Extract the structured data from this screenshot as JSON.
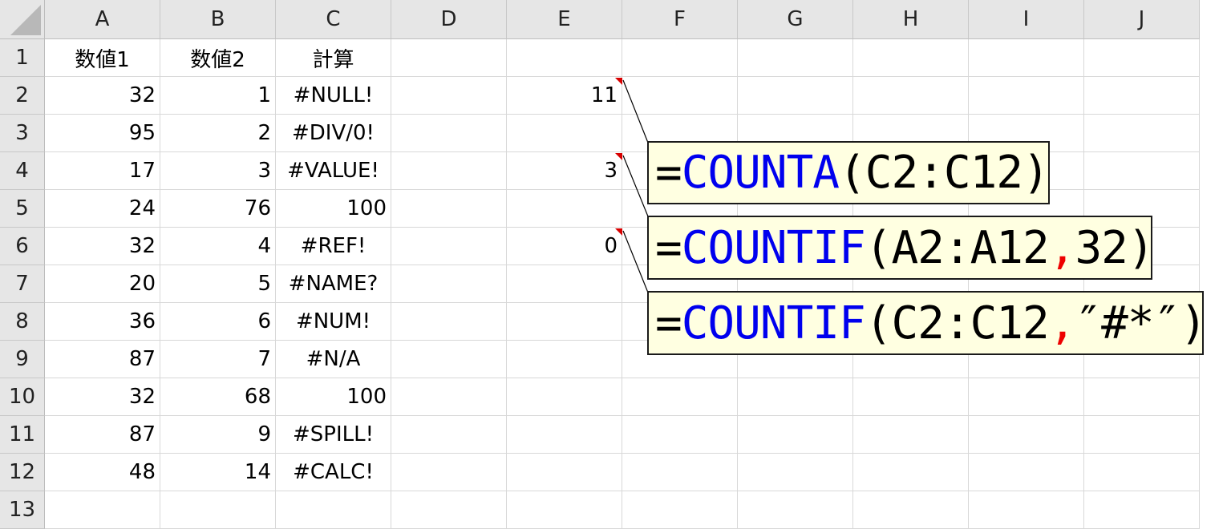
{
  "spreadsheet": {
    "columns": [
      "A",
      "B",
      "C",
      "D",
      "E",
      "F",
      "G",
      "H",
      "I",
      "J"
    ],
    "rows": [
      "1",
      "2",
      "3",
      "4",
      "5",
      "6",
      "7",
      "8",
      "9",
      "10",
      "11",
      "12",
      "13"
    ],
    "headers": {
      "a1": "数値1",
      "b1": "数値2",
      "c1": "計算"
    },
    "data": [
      {
        "a": "32",
        "b": "1",
        "c": "#NULL!"
      },
      {
        "a": "95",
        "b": "2",
        "c": "#DIV/0!"
      },
      {
        "a": "17",
        "b": "3",
        "c": "#VALUE!"
      },
      {
        "a": "24",
        "b": "76",
        "c": "100"
      },
      {
        "a": "32",
        "b": "4",
        "c": "#REF!"
      },
      {
        "a": "20",
        "b": "5",
        "c": "#NAME?"
      },
      {
        "a": "36",
        "b": "6",
        "c": "#NUM!"
      },
      {
        "a": "87",
        "b": "7",
        "c": "#N/A"
      },
      {
        "a": "32",
        "b": "68",
        "c": "100"
      },
      {
        "a": "87",
        "b": "9",
        "c": "#SPILL!"
      },
      {
        "a": "48",
        "b": "14",
        "c": "#CALC!"
      }
    ],
    "results": {
      "e2": "11",
      "e4": "3",
      "e6": "0"
    }
  },
  "comments": [
    {
      "eq": "=",
      "fn": "COUNTA",
      "args": "(C2:C12)",
      "crit": "",
      "sep": "",
      "close": ""
    },
    {
      "eq": "=",
      "fn": "COUNTIF",
      "args": "(A2:A12",
      "sep": ",",
      "crit": " 32",
      "close": ")"
    },
    {
      "eq": "=",
      "fn": "COUNTIF",
      "args": "(C2:C12",
      "sep": ",",
      "crit": " ″#*″",
      "close": ")"
    }
  ],
  "colors": {
    "function_name": "#0000ee",
    "separator": "#ee0000",
    "comment_bg": "#ffffe1",
    "comment_marker": "#d80000"
  }
}
